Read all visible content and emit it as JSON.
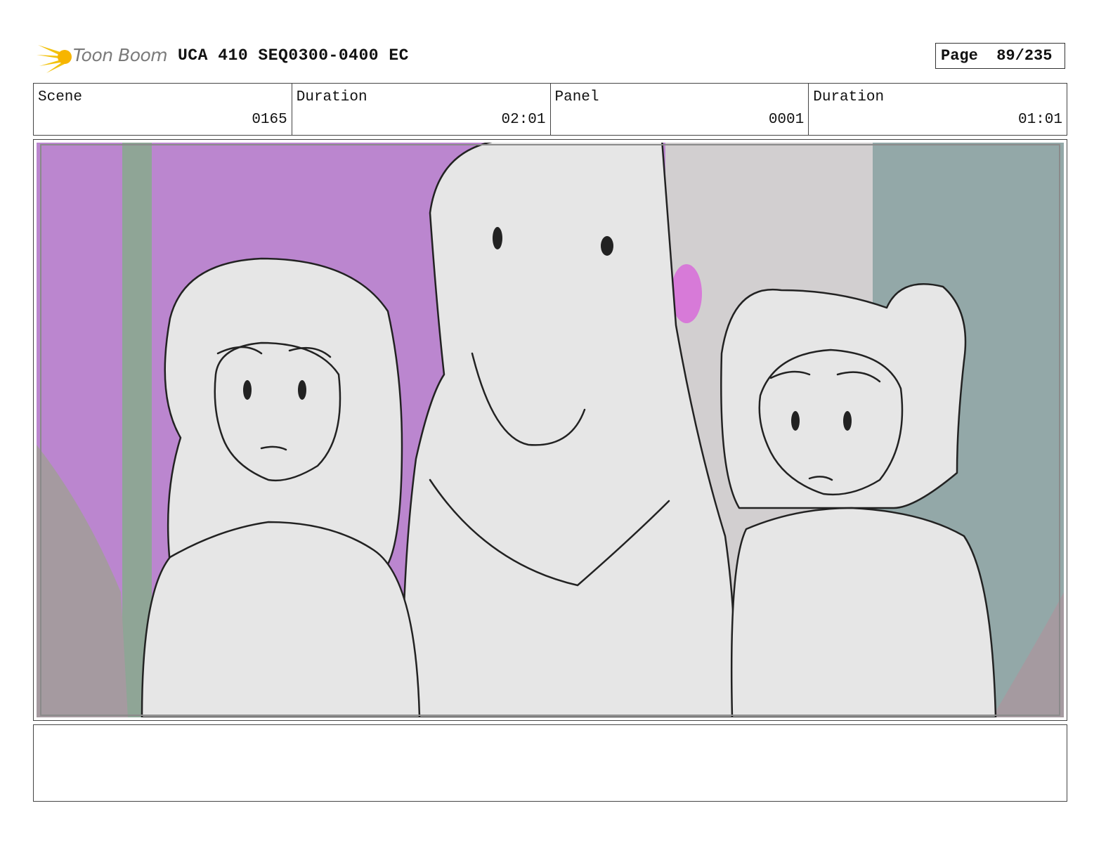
{
  "header": {
    "logo_text": "Toon Boom",
    "title": "UCA 410 SEQ0300-0400 EC",
    "page_label": "Page",
    "page_value": "89/235"
  },
  "info": {
    "scene_label": "Scene",
    "scene_value": "0165",
    "duration_label": "Duration",
    "duration_value": "02:01",
    "panel_label": "Panel",
    "panel_value": "0001",
    "panel_duration_label": "Duration",
    "panel_duration_value": "01:01"
  },
  "colors": {
    "wall_purple": "#bb86cf",
    "curtain_teal": "#93a8a8",
    "sketch_fill": "#e6e6e6",
    "pink_accent": "#d77ad8"
  },
  "notes": {
    "text": ""
  }
}
